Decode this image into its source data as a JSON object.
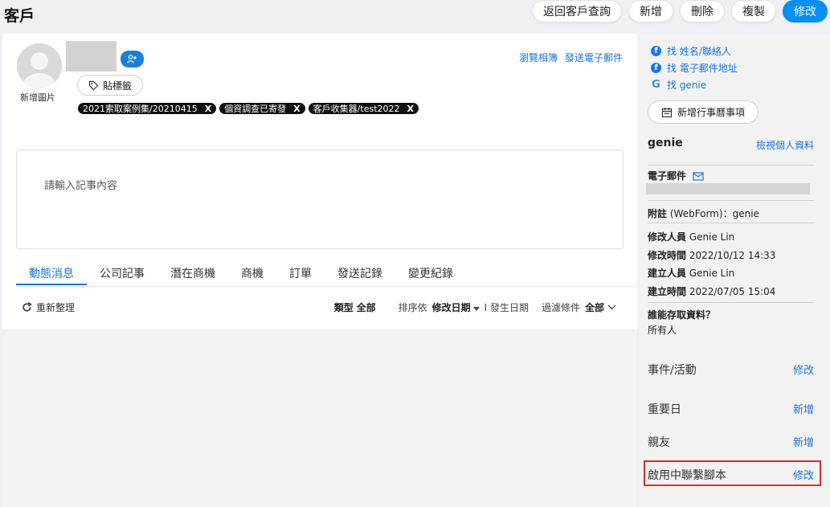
{
  "header": {
    "title": "客戶",
    "buttons": {
      "back": "返回客戶查詢",
      "add": "新增",
      "delete": "刪除",
      "copy": "複製",
      "edit": "修改"
    }
  },
  "profile": {
    "add_image_label": "新增圖片",
    "badge_text": "ꈝ¹",
    "tag_button": "貼標籤",
    "tags": [
      "2021索取案例集/20210415",
      "個資調查已寄發",
      "客戶收集器/test2022"
    ],
    "tag_remove": "X",
    "links": {
      "browse_album": "瀏覽相簿",
      "send_email": "發送電子郵件"
    }
  },
  "note": {
    "placeholder": "請輸入記事內容"
  },
  "tabs": [
    "動態消息",
    "公司記事",
    "潛在商機",
    "商機",
    "訂單",
    "發送記錄",
    "變更紀錄"
  ],
  "filter_bar": {
    "refresh": "重新整理",
    "type_label": "類型",
    "type_value": "全部",
    "sort_label": "排序依",
    "sort_value": "修改日期",
    "sort_alt": "I 發生日期",
    "condition_label": "過濾條件",
    "condition_value": "全部"
  },
  "sidebar": {
    "find_name": "找 姓名/聯絡人",
    "find_email": "找 電子郵件地址",
    "find_google": "找 genie",
    "add_calendar": "新增行事曆事項",
    "contact_name": "genie",
    "view_profile": "檢視個人資料",
    "email_label": "電子郵件",
    "note_label": "附註",
    "note_value": "(WebForm)：genie",
    "modified_by_label": "修改人員",
    "modified_by": "Genie Lin",
    "modified_at_label": "修改時間",
    "modified_at": "2022/10/12 14:33",
    "created_by_label": "建立人員",
    "created_by": "Genie Lin",
    "created_at_label": "建立時間",
    "created_at": "2022/07/05 15:04",
    "access_label": "誰能存取資料？",
    "access_value": "所有人",
    "sections": [
      {
        "label": "事件/活動",
        "action": "修改"
      },
      {
        "label": "重要日",
        "action": "新增"
      },
      {
        "label": "親友",
        "action": "新增"
      },
      {
        "label": "啟用中聯繫腳本",
        "action": "修改"
      }
    ]
  },
  "colors": {
    "accent": "#0a8ef0",
    "link": "#1a73d9",
    "tag_bg": "#111111",
    "highlight": "#d32f2f"
  }
}
